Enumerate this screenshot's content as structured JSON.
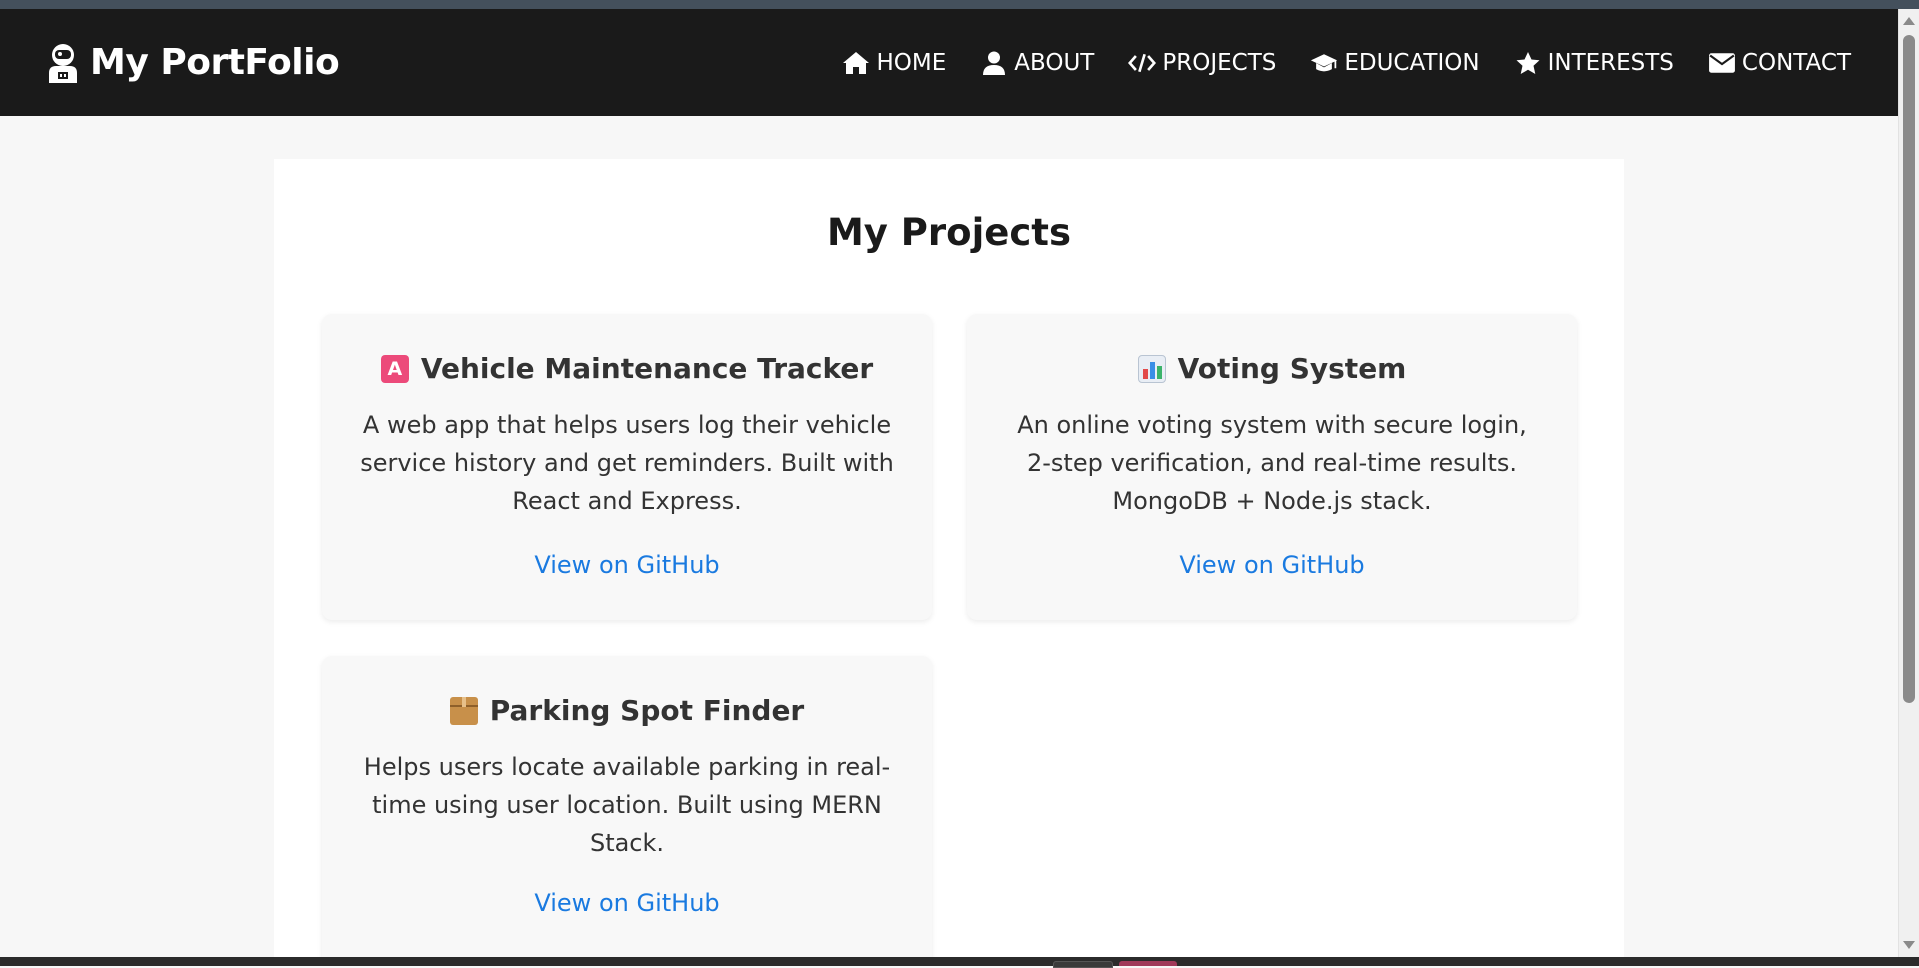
{
  "brand": {
    "title": "My PortFolio",
    "icon": "astronaut-icon"
  },
  "nav": [
    {
      "label": "HOME",
      "icon": "home-icon"
    },
    {
      "label": "ABOUT",
      "icon": "user-icon"
    },
    {
      "label": "PROJECTS",
      "icon": "code-icon"
    },
    {
      "label": "EDUCATION",
      "icon": "graduation-cap-icon"
    },
    {
      "label": "INTERESTS",
      "icon": "star-icon"
    },
    {
      "label": "CONTACT",
      "icon": "envelope-icon"
    }
  ],
  "projects": {
    "title": "My Projects",
    "cards": [
      {
        "title": "Vehicle Maintenance Tracker",
        "emoji": "letter-a-emoji-icon",
        "description": "A web app that helps users log their vehicle service history and get reminders. Built with React and Express.",
        "link": "View on GitHub"
      },
      {
        "title": "Voting System",
        "emoji": "bar-chart-emoji-icon",
        "description": "An online voting system with secure login, 2-step verification, and real-time results. MongoDB + Node.js stack.",
        "link": "View on GitHub"
      },
      {
        "title": "Parking Spot Finder",
        "emoji": "package-emoji-icon",
        "description": "Helps users locate available parking in real-time using user location. Built using MERN Stack.",
        "link": "View on GitHub"
      }
    ]
  },
  "colors": {
    "navbar_bg": "#1a1a1a",
    "page_bg": "#f7f7f7",
    "card_bg": "#f8f8f8",
    "link": "#1a7ae0",
    "text": "#333333"
  }
}
